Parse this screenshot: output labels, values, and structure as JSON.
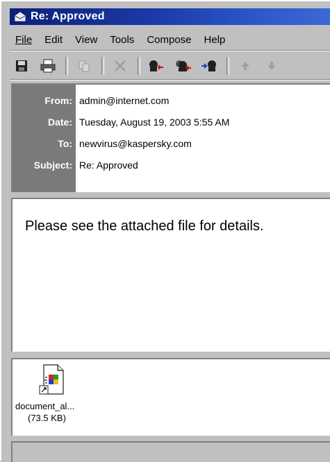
{
  "window": {
    "title": "Re: Approved",
    "title_bar_color": "#0a1f7a"
  },
  "menu": {
    "file": "File",
    "edit": "Edit",
    "view": "View",
    "tools": "Tools",
    "compose": "Compose",
    "help": "Help"
  },
  "toolbar": {
    "icons": [
      "save-icon",
      "print-icon",
      "copy-icon",
      "delete-icon",
      "reply-icon",
      "reply-all-icon",
      "forward-icon",
      "previous-icon",
      "next-icon"
    ]
  },
  "header": {
    "from_label": "From:",
    "from_value": "admin@internet.com",
    "date_label": "Date:",
    "date_value": "Tuesday, August 19, 2003 5:55 AM",
    "to_label": "To:",
    "to_value": "newvirus@kaspersky.com",
    "subject_label": "Subject:",
    "subject_value": "Re: Approved"
  },
  "body": {
    "text": "Please see the attached file for details."
  },
  "attachment": {
    "name": "document_al...",
    "size": "(73.5 KB)"
  }
}
